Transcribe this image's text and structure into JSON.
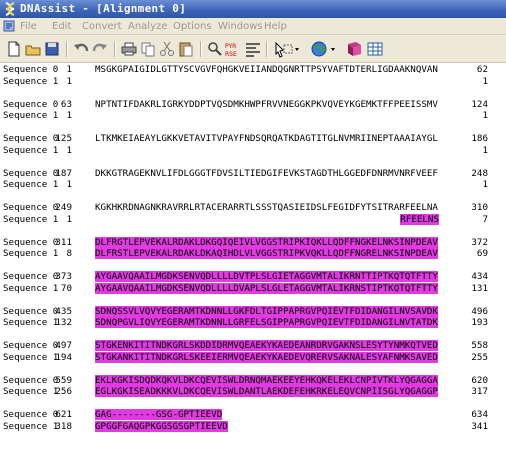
{
  "window": {
    "title": "DNAssist - [Alignment 0]"
  },
  "menu": [
    "File",
    "Edit",
    "Convert",
    "Analyze",
    "Options",
    "Windows",
    "Help"
  ],
  "toolbar": [
    "new-icon",
    "open-icon",
    "save-icon",
    "undo-icon",
    "redo-icon",
    "print-icon",
    "copy-icon",
    "cut-icon",
    "paste-icon",
    "find-icon",
    "restriction-icon",
    "align-icon",
    "select-icon",
    "web-icon",
    "book-icon",
    "grid-icon"
  ],
  "blocks": [
    {
      "a": {
        "name": "Sequence 0",
        "start": "1",
        "res": "MSGKGPAIGIDLGTTYSCVGVFQHGKVEIIANDQGNRTTPSYVAFTDTERLIGDAAKNQVAN",
        "end": "62"
      },
      "b": {
        "name": "Sequence 1",
        "start": "1",
        "res": "",
        "end": "1"
      }
    },
    {
      "a": {
        "name": "Sequence 0",
        "start": "63",
        "res": "NPTNTIFDAKRLIGRKYDDPTVQSDMKHWPFRVVNEGGKPKVQVEYKGEMKTFFPEEISSMV",
        "end": "124"
      },
      "b": {
        "name": "Sequence 1",
        "start": "1",
        "res": "",
        "end": "1"
      }
    },
    {
      "a": {
        "name": "Sequence 0",
        "start": "125",
        "res": "LTKMKEIAEAYLGKKVETAVITVPAYFNDSQRQATKDAGTITGLNVMRIINEPTAAAIAYGL",
        "end": "186"
      },
      "b": {
        "name": "Sequence 1",
        "start": "1",
        "res": "",
        "end": "1"
      }
    },
    {
      "a": {
        "name": "Sequence 0",
        "start": "187",
        "res": "DKKGTRAGEKNVLIFDLGGGTFDVSILTIEDGIFEVKSTAGDTHLGGEDFDNRMVNRFVEEF",
        "end": "248"
      },
      "b": {
        "name": "Sequence 1",
        "start": "1",
        "res": "",
        "end": "1"
      }
    },
    {
      "a": {
        "name": "Sequence 0",
        "start": "249",
        "res": "KGKHKRDNAGNKRAVRRLRTACERARRTLSSSTQASIEIDSLFEGIDFYTSITRARFEELNA",
        "end": "310"
      },
      "b": {
        "name": "Sequence 1",
        "start": "1",
        "res": "RFEELNS",
        "end": "7"
      }
    },
    {
      "a": {
        "name": "Sequence 0",
        "start": "311",
        "res": "DLFRGTLEPVEKALRDAKLDKGQIQEIVLVGGSTRIPKIQKLLQDFFNGKELNKSINPDEAV",
        "end": "372"
      },
      "b": {
        "name": "Sequence 1",
        "start": "8",
        "res": "DLFRSTLEPVEKALRDAKLDKAQIHDLVLVGGSTRIPKVQKLLQDFFNGRELNKSINPDEAV",
        "end": "69"
      }
    },
    {
      "a": {
        "name": "Sequence 0",
        "start": "373",
        "res": "AYGAAVQAAILMGDKSENVQDLLLLDVTPLSLGIETAGGVMTALIKRNTTIPTKQTQTFTTY",
        "end": "434"
      },
      "b": {
        "name": "Sequence 1",
        "start": "70",
        "res": "AYGAAVQAAILMGDKSENVQDLLLLDVAPLSLGLETAGGVMTALIKRNSTIPTKQTQTFTTY",
        "end": "131"
      }
    },
    {
      "a": {
        "name": "Sequence 0",
        "start": "435",
        "res": "SDNQSSVLVQVYEGERAMTKDNNLLGKFDLTGIPPAPRGVPQIEVTFDIDANGILNVSAVDK",
        "end": "496"
      },
      "b": {
        "name": "Sequence 1",
        "start": "132",
        "res": "SDNQPGVLIQVYEGERAMTKDNNLLGRFELSGIPPAPRGVPQIEVTFDIDANGILNVTATDK",
        "end": "193"
      }
    },
    {
      "a": {
        "name": "Sequence 0",
        "start": "497",
        "res": "STGKENKITITNDKGRLSKDDIDRMVQEAEKYKAEDEANRDRVGAKNSLESYTYNMKQTVED",
        "end": "558"
      },
      "b": {
        "name": "Sequence 1",
        "start": "194",
        "res": "STGKANKITITNDKGRLSKEEIERMVQEAEKYKAEDEVQRERVSAKNALESYAFNMKSAVED",
        "end": "255"
      }
    },
    {
      "a": {
        "name": "Sequence 0",
        "start": "559",
        "res": "EKLKGKISDQDKQKVLDKCQEVISWLDRNQMAEKEEYEHKQKELEKLCNPIVTKLYQGAGGA",
        "end": "620"
      },
      "b": {
        "name": "Sequence 1",
        "start": "256",
        "res": "EGLKGKISEADKKKVLDKCQEVISWLDANTLAEKDEFEHKRKELEQVCNPIISGLYQGAGGP",
        "end": "317"
      }
    },
    {
      "a": {
        "name": "Sequence 0",
        "start": "621",
        "res": "GAG--------GSG-GPTIEEVD",
        "end": "634"
      },
      "b": {
        "name": "Sequence 1",
        "start": "318",
        "res": "GPGGFGAQGPKGGSGSGPTIEEVD",
        "end": "341"
      }
    }
  ]
}
